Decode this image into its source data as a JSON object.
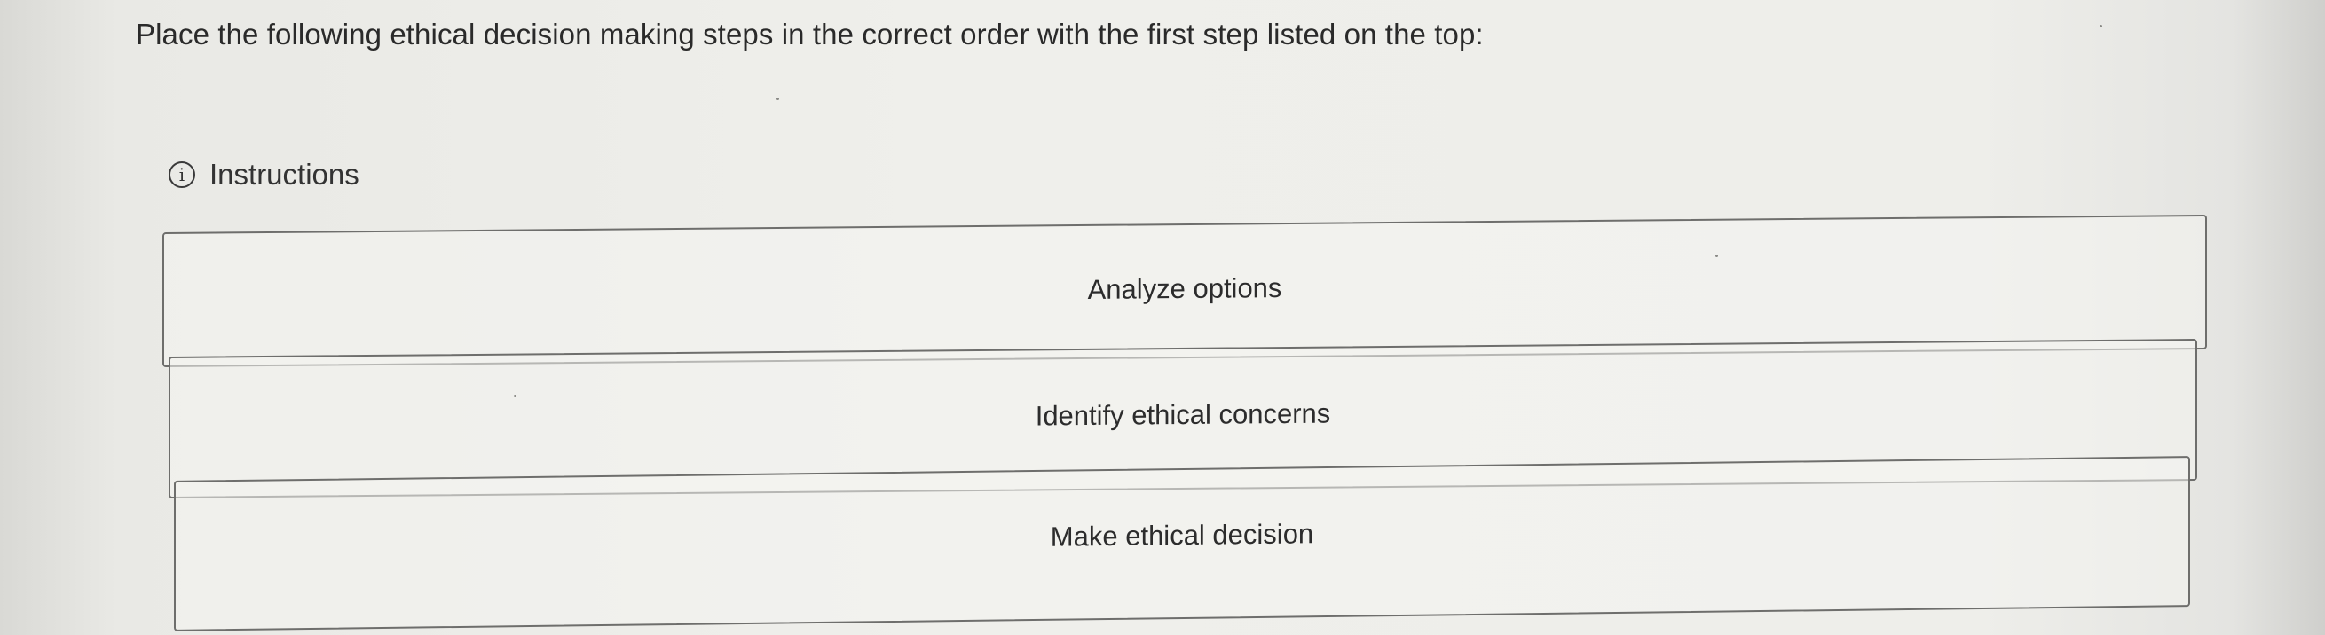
{
  "question": {
    "prompt": "Place the following ethical decision making steps in the correct order with the first step listed on the top:"
  },
  "instructions": {
    "icon": "info-icon",
    "icon_glyph": "i",
    "label": "Instructions"
  },
  "steps": [
    {
      "label": "Analyze options"
    },
    {
      "label": "Identify ethical concerns"
    },
    {
      "label": "Make ethical decision"
    }
  ]
}
